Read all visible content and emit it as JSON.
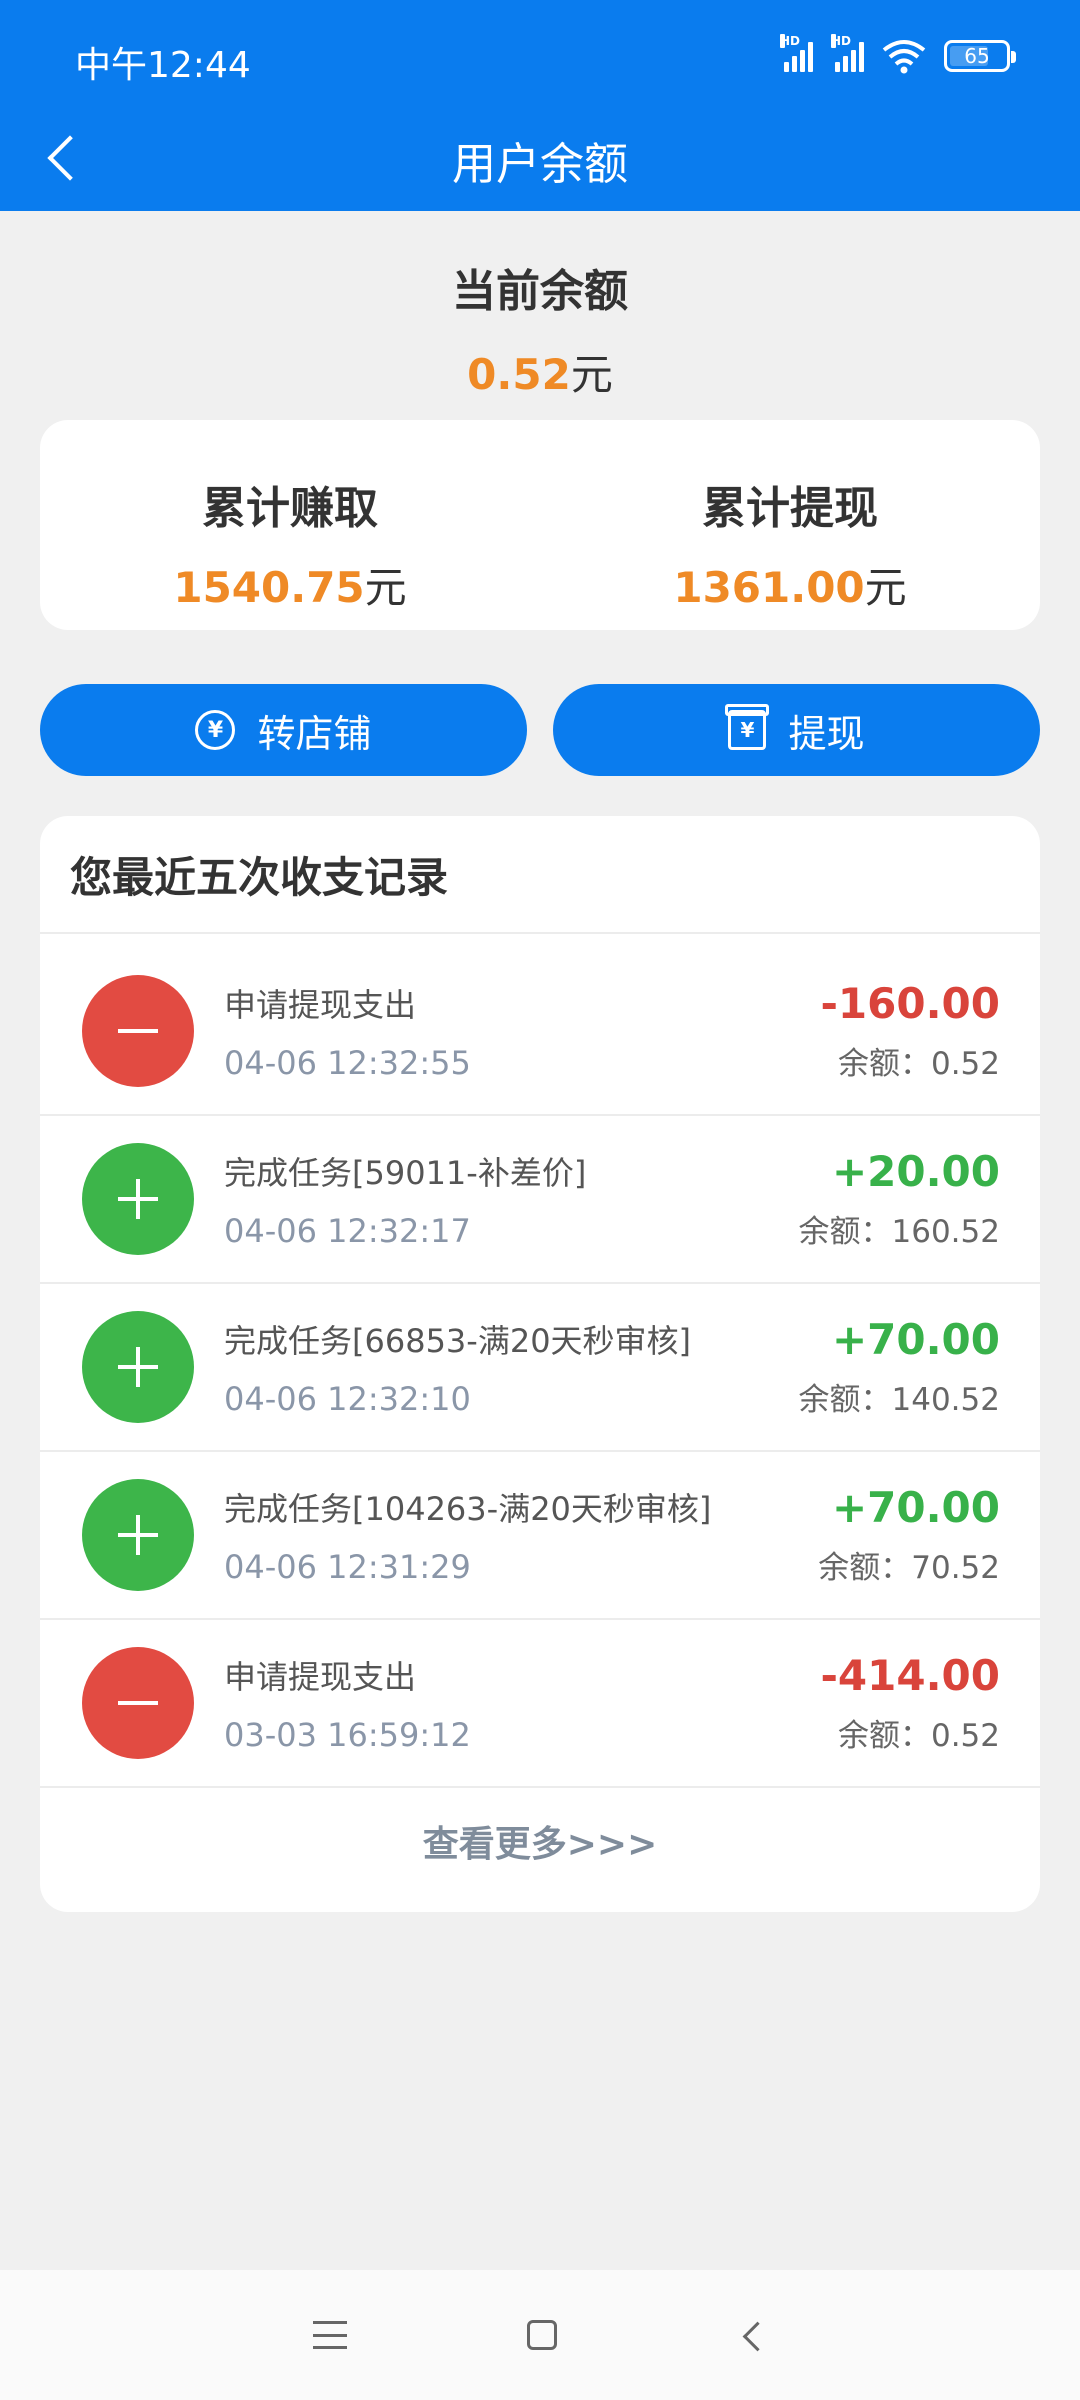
{
  "status_bar": {
    "time": "中午12:44",
    "signal_label_1": "HD",
    "signal_label_2": "HD",
    "battery": "65",
    "icons": [
      "signal-icon",
      "signal-icon",
      "wifi-icon",
      "battery-icon"
    ]
  },
  "header": {
    "title": "用户余额",
    "back_icon": "chevron-left-icon"
  },
  "balance": {
    "label": "当前余额",
    "amount": "0.52",
    "unit": "元"
  },
  "summary": {
    "earned": {
      "label": "累计赚取",
      "amount": "1540.75",
      "unit": "元"
    },
    "withdrawn": {
      "label": "累计提现",
      "amount": "1361.00",
      "unit": "元"
    }
  },
  "actions": {
    "transfer": {
      "label": "转店铺",
      "icon": "yen-coin-icon",
      "icon_glyph": "¥"
    },
    "withdraw": {
      "label": "提现",
      "icon": "yen-box-icon",
      "icon_glyph": "¥"
    }
  },
  "records": {
    "title": "您最近五次收支记录",
    "items": [
      {
        "type": "minus",
        "title": "申请提现支出",
        "time": "04-06 12:32:55",
        "amount": "-160.00",
        "balance": "余额：0.52"
      },
      {
        "type": "plus",
        "title": "完成任务[59011-补差价]",
        "time": "04-06 12:32:17",
        "amount": "+20.00",
        "balance": "余额：160.52"
      },
      {
        "type": "plus",
        "title": "完成任务[66853-满20天秒审核]",
        "time": "04-06 12:32:10",
        "amount": "+70.00",
        "balance": "余额：140.52"
      },
      {
        "type": "plus",
        "title": "完成任务[104263-满20天秒审核]",
        "time": "04-06 12:31:29",
        "amount": "+70.00",
        "balance": "余额：70.52"
      },
      {
        "type": "minus",
        "title": "申请提现支出",
        "time": "03-03 16:59:12",
        "amount": "-414.00",
        "balance": "余额：0.52"
      }
    ],
    "more_label": "查看更多>>>"
  },
  "system_nav": {
    "icons": [
      "menu-icon",
      "home-icon",
      "back-icon"
    ]
  },
  "colors": {
    "primary": "#0a7cee",
    "orange": "#ef8a26",
    "expense": "#e24b42",
    "income": "#3db54a"
  }
}
